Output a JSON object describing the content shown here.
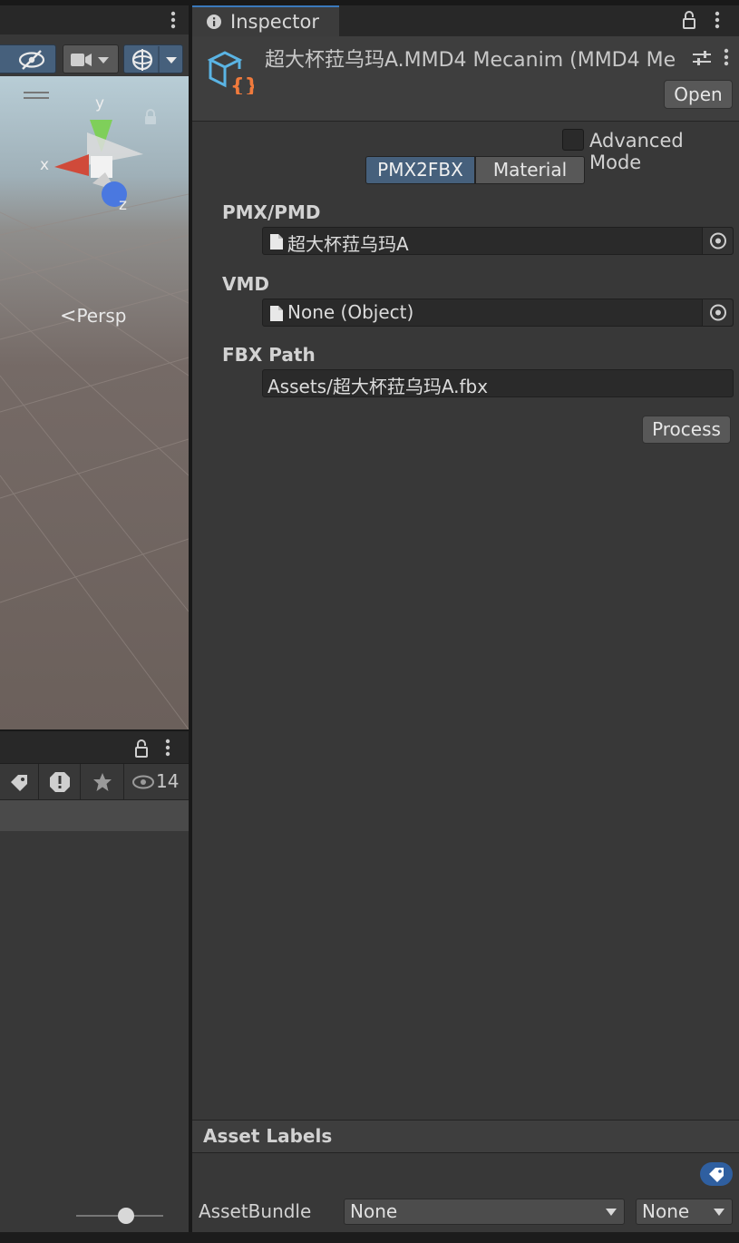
{
  "scene": {
    "persp_label": "Persp",
    "axis_x": "x",
    "axis_y": "y",
    "axis_z": "z"
  },
  "project": {
    "visible_count": "14"
  },
  "inspector": {
    "tab_label": "Inspector",
    "asset_title": "超大杯菈乌玛A.MMD4 Mecanim (MMD4 Me",
    "open_label": "Open",
    "advanced_mode_label": "Advanced Mode",
    "advanced_mode_checked": false,
    "tabs": [
      {
        "label": "PMX2FBX",
        "active": true
      },
      {
        "label": "Material",
        "active": false
      }
    ],
    "pmx_label": "PMX/PMD",
    "pmx_value": "超大杯菈乌玛A",
    "vmd_label": "VMD",
    "vmd_value": "None (Object)",
    "fbx_label": "FBX Path",
    "fbx_value": "Assets/超大杯菈乌玛A.fbx",
    "process_label": "Process"
  },
  "asset_labels": {
    "title": "Asset Labels",
    "bundle_label": "AssetBundle",
    "bundle_name": "None",
    "bundle_variant": "None"
  },
  "colors": {
    "accent": "#3a79bb",
    "active_tab": "#46607c",
    "panel_bg": "#383838"
  }
}
